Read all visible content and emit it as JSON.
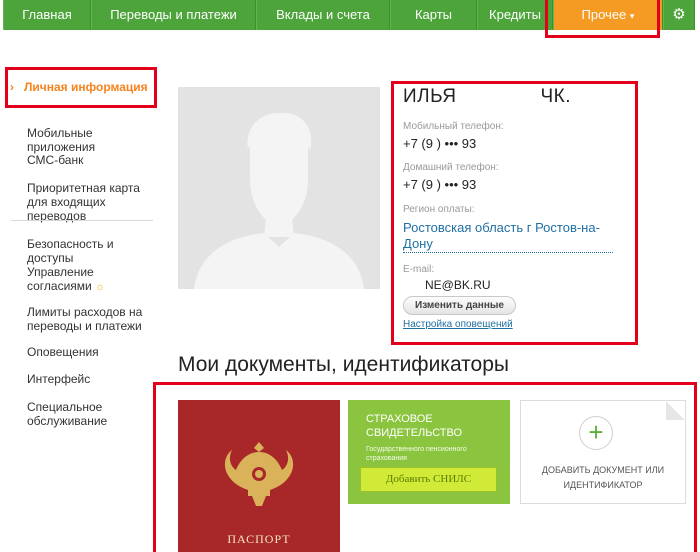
{
  "nav": {
    "items": [
      "Главная",
      "Переводы и платежи",
      "Вклады и счета",
      "Карты",
      "Кредиты"
    ],
    "more_label": "Прочее",
    "more_caret": "▾",
    "gear_icon": "gear-icon"
  },
  "sidebar": {
    "active": "Личная информация",
    "group1": [
      "Мобильные приложения",
      "СМС-банк",
      "Приоритетная карта для входящих переводов"
    ],
    "group2": [
      "Безопасность и доступы",
      "Управление согласиями",
      "Лимиты расходов на переводы и платежи",
      "Оповещения",
      "Интерфейс",
      "Специальное обслуживание"
    ]
  },
  "profile": {
    "name": "ИЛЬЯ",
    "name_suffix": "ЧК.",
    "mobile_label": "Мобильный телефон:",
    "mobile_value": "+7 (9      )  •••  93",
    "home_label": "Домашний телефон:",
    "home_value": "+7 (9      )  •••  93",
    "region_label": "Регион оплаты:",
    "region_value": "Ростовская область г Ростов-на-Дону",
    "email_label": "E-mail:",
    "email_value": "NE@BK.RU",
    "change_button": "Изменить данные",
    "notifications_link": "Настройка оповещений"
  },
  "documents": {
    "title": "Мои документы, идентификаторы",
    "passport_label": "ПАСПОРТ",
    "snils_title": "СТРАХОВОЕ СВИДЕТЕЛЬСТВО",
    "snils_subtitle": "Государственного пенсионного страхования",
    "snils_button": "Добавить СНИЛС",
    "add_document": "ДОБАВИТЬ ДОКУМЕНТ ИЛИ ИДЕНТИФИКАТОР"
  },
  "colors": {
    "nav_green": "#4da43a",
    "nav_active": "#f59a23",
    "highlight_red": "#e3001b",
    "link_blue": "#1f6fa3",
    "passport_red": "#a8282a",
    "snils_green": "#8bc53f"
  }
}
